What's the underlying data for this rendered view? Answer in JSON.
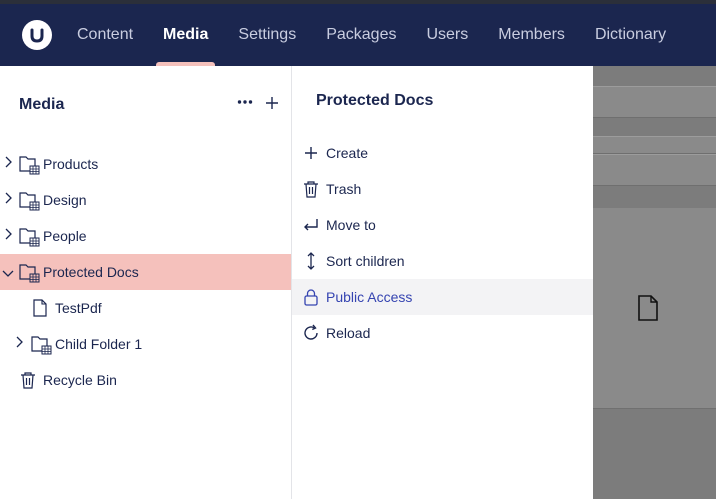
{
  "header": {
    "nav": [
      {
        "label": "Content",
        "active": false
      },
      {
        "label": "Media",
        "active": true
      },
      {
        "label": "Settings",
        "active": false
      },
      {
        "label": "Packages",
        "active": false
      },
      {
        "label": "Users",
        "active": false
      },
      {
        "label": "Members",
        "active": false
      },
      {
        "label": "Dictionary",
        "active": false
      }
    ],
    "logo_icon": "umbraco-logo-icon"
  },
  "tree": {
    "title": "Media",
    "more_icon": "ellipsis-icon",
    "add_icon": "plus-icon",
    "items": [
      {
        "label": "Products",
        "icon": "folder-grid-icon",
        "has_children": true,
        "expanded": false,
        "level": 0
      },
      {
        "label": "Design",
        "icon": "folder-grid-icon",
        "has_children": true,
        "expanded": false,
        "level": 0
      },
      {
        "label": "People",
        "icon": "folder-grid-icon",
        "has_children": true,
        "expanded": false,
        "level": 0
      },
      {
        "label": "Protected Docs",
        "icon": "folder-grid-icon",
        "has_children": true,
        "expanded": true,
        "level": 0,
        "selected": true
      },
      {
        "label": "TestPdf",
        "icon": "document-icon",
        "has_children": false,
        "level": 1
      },
      {
        "label": "Child Folder 1",
        "icon": "folder-grid-icon",
        "has_children": true,
        "expanded": false,
        "level": 1
      },
      {
        "label": "Recycle Bin",
        "icon": "trash-icon",
        "has_children": false,
        "level": 0
      }
    ]
  },
  "actions": {
    "title": "Protected Docs",
    "items": [
      {
        "label": "Create",
        "icon": "plus-icon"
      },
      {
        "label": "Trash",
        "icon": "trash-icon"
      },
      {
        "label": "Move to",
        "icon": "move-arrow-icon"
      },
      {
        "label": "Sort children",
        "icon": "sort-arrows-icon"
      },
      {
        "label": "Public Access",
        "icon": "lock-icon",
        "highlighted": true
      },
      {
        "label": "Reload",
        "icon": "reload-icon"
      }
    ]
  },
  "colors": {
    "header_bg": "#1b264f",
    "selected_bg": "#f5c1bc",
    "accent_text": "#3544b1",
    "overlay": "#7c7c7c"
  }
}
